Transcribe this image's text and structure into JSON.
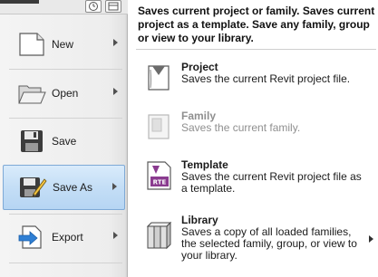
{
  "menu": {
    "items": [
      {
        "label": "New",
        "icon": "new-document-icon",
        "has_submenu": true
      },
      {
        "label": "Open",
        "icon": "folder-open-icon",
        "has_submenu": true
      },
      {
        "label": "Save",
        "icon": "floppy-disk-icon",
        "has_submenu": false
      },
      {
        "label": "Save As",
        "icon": "save-as-icon",
        "has_submenu": true,
        "active": true
      },
      {
        "label": "Export",
        "icon": "export-icon",
        "has_submenu": true
      }
    ],
    "quick_buttons": [
      "recent-documents-icon",
      "open-documents-icon"
    ]
  },
  "submenu": {
    "header": "Saves current project or family. Saves current project as a template. Save any family, group or view to your library.",
    "items": [
      {
        "title": "Project",
        "description": "Saves the current Revit project file.",
        "icon": "project-icon",
        "enabled": true
      },
      {
        "title": "Family",
        "description": "Saves the current family.",
        "icon": "family-icon",
        "enabled": false
      },
      {
        "title": "Template",
        "description": "Saves the current Revit project file as a template.",
        "icon": "rte-template-icon",
        "enabled": true
      },
      {
        "title": "Library",
        "description": "Saves a copy of all loaded families, the selected family, group, or view to your library.",
        "icon": "library-books-icon",
        "enabled": true,
        "has_submenu": true
      }
    ]
  },
  "colors": {
    "active_bg": "#c4def6",
    "active_border": "#7ea9d6",
    "disabled_text": "#8f8f8f",
    "template_icon": "#8a3b8f"
  }
}
